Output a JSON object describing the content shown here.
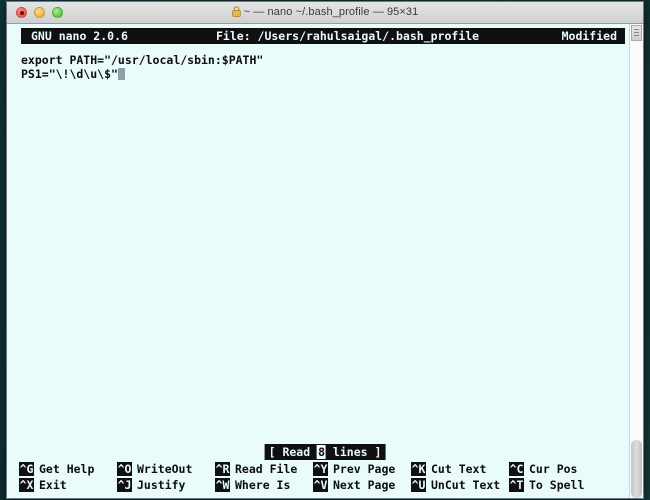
{
  "window": {
    "title": "~ — nano ~/.bash_profile — 95×31",
    "title_icon": "lock-icon",
    "controls": {
      "close": "close-button",
      "minimize": "minimize-button",
      "maximize": "maximize-button"
    }
  },
  "nano": {
    "version": "GNU nano 2.0.6",
    "file_label": "File: /Users/rahulsaigal/.bash_profile",
    "modified": "Modified",
    "status_prefix": "[ Read ",
    "status_count": "8",
    "status_suffix": " lines ]",
    "lines": [
      "export PATH=\"/usr/local/sbin:$PATH\"",
      "PS1=\"\\!\\d\\u\\$\""
    ]
  },
  "shortcuts": {
    "row1": [
      {
        "key": "^G",
        "label": "Get Help"
      },
      {
        "key": "^O",
        "label": "WriteOut"
      },
      {
        "key": "^R",
        "label": "Read File"
      },
      {
        "key": "^Y",
        "label": "Prev Page"
      },
      {
        "key": "^K",
        "label": "Cut Text"
      },
      {
        "key": "^C",
        "label": "Cur Pos"
      }
    ],
    "row2": [
      {
        "key": "^X",
        "label": "Exit"
      },
      {
        "key": "^J",
        "label": "Justify"
      },
      {
        "key": "^W",
        "label": "Where Is"
      },
      {
        "key": "^V",
        "label": "Next Page"
      },
      {
        "key": "^U",
        "label": "UnCut Text"
      },
      {
        "key": "^T",
        "label": "To Spell"
      }
    ]
  },
  "colors": {
    "terminal_background": "#e9fbfb",
    "terminal_foreground": "#101010",
    "desktop": "#11353a",
    "cursor": "#8f9fa3"
  }
}
